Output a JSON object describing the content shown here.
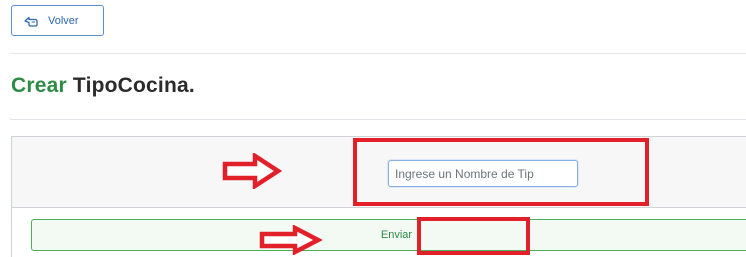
{
  "back_button": {
    "label": "Volver",
    "icon": "hand-pointing-left-icon"
  },
  "page_title": {
    "verb": "Crear",
    "noun": "TipoCocina."
  },
  "form": {
    "name_input": {
      "value": "",
      "placeholder": "Ingrese un Nombre de Tip"
    },
    "submit_label": "Enviar"
  },
  "annotations": {
    "arrow_icon": "right-arrow-icon",
    "highlight_color": "#e2202a"
  },
  "colors": {
    "accent_blue": "#2f66b3",
    "accent_green": "#2e8b45"
  }
}
